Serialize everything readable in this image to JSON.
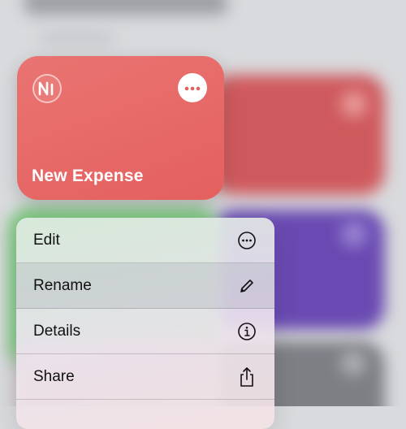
{
  "shortcut_card": {
    "title": "New Expense",
    "app_icon": "n-logo-icon",
    "more_icon": "ellipsis-icon",
    "color": "#e66a68"
  },
  "context_menu": {
    "items": [
      {
        "label": "Edit",
        "icon": "ellipsis-circle-icon"
      },
      {
        "label": "Rename",
        "icon": "pencil-icon"
      },
      {
        "label": "Details",
        "icon": "info-circle-icon"
      },
      {
        "label": "Share",
        "icon": "share-icon"
      }
    ]
  }
}
